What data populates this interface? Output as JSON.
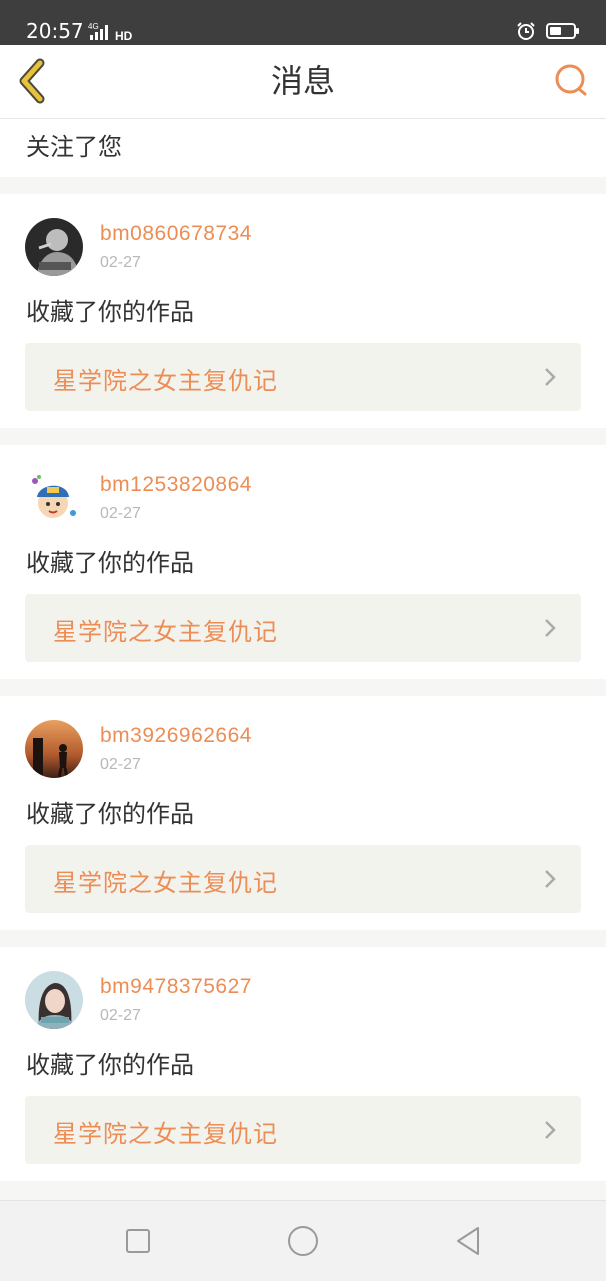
{
  "status_bar": {
    "time": "20:57",
    "network": "4G",
    "hd": "HD"
  },
  "header": {
    "title": "消息"
  },
  "partial_item": {
    "text": "关注了您"
  },
  "messages": [
    {
      "username": "bm0860678734",
      "date": "02-27",
      "action": "收藏了你的作品",
      "work_title": "星学院之女主复仇记",
      "avatar": "person-smoking-avatar"
    },
    {
      "username": "bm1253820864",
      "date": "02-27",
      "action": "收藏了你的作品",
      "work_title": "星学院之女主复仇记",
      "avatar": "cartoon-child-avatar"
    },
    {
      "username": "bm3926962664",
      "date": "02-27",
      "action": "收藏了你的作品",
      "work_title": "星学院之女主复仇记",
      "avatar": "sunset-silhouette-avatar"
    },
    {
      "username": "bm9478375627",
      "date": "02-27",
      "action": "收藏了你的作品",
      "work_title": "星学院之女主复仇记",
      "avatar": "girl-portrait-avatar"
    }
  ],
  "colors": {
    "accent": "#ec8d55",
    "back_arrow": "#e8c23a",
    "status_bar": "#3e3e3e",
    "card_link_bg": "#f3f3ee"
  }
}
